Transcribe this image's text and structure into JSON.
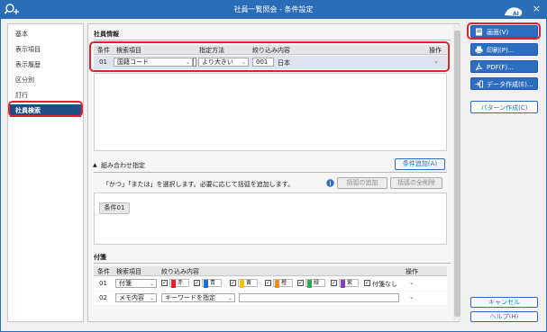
{
  "window": {
    "title": "社員一覧照会 - 条件設定",
    "close": "×"
  },
  "nav": {
    "items": [
      "基本",
      "表示項目",
      "表示履歴",
      "区分別",
      "訂行",
      "社員検索"
    ]
  },
  "employee_info": {
    "header": "社員情報",
    "columns": [
      "条件",
      "検索項目",
      "指定方法",
      "絞り込み内容",
      "操作"
    ],
    "row": {
      "no": "01",
      "item": "国籍コード",
      "method": "より大きい",
      "code": "001",
      "value": "日本"
    }
  },
  "combination": {
    "header": "組み合わせ指定",
    "add_button": "条件追加(A)",
    "hint": "「かつ」「または」を選択します。必要に応じて括弧を追加します。",
    "add_paren": "括弧の追加",
    "remove_paren": "括弧の全削除",
    "tag": "条件01"
  },
  "tags_section": {
    "header": "付箋",
    "columns": [
      "条件",
      "検索項目",
      "絞り込み内容",
      "操作"
    ],
    "row1": {
      "no": "01",
      "item": "付箋",
      "colors": [
        "赤",
        "青",
        "黄",
        "橙",
        "緑",
        "紫"
      ],
      "none_label": "付箋なし"
    },
    "row2": {
      "no": "02",
      "item": "メモ内容",
      "method": "キーワードを指定"
    },
    "color_hex": {
      "赤": "#e8202a",
      "青": "#1e6fd0",
      "黄": "#f2c400",
      "橙": "#f28a1c",
      "緑": "#2fa84a",
      "紫": "#8a3fb2"
    }
  },
  "right_buttons": {
    "screen": "画面(V)",
    "print": "印刷(P)...",
    "pdf": "PDF(F)...",
    "data": "データ作成(E)...",
    "pattern": "パターン作成(C)",
    "cancel": "キャンセル",
    "help": "ヘルプ(H)"
  },
  "logo": "AI"
}
